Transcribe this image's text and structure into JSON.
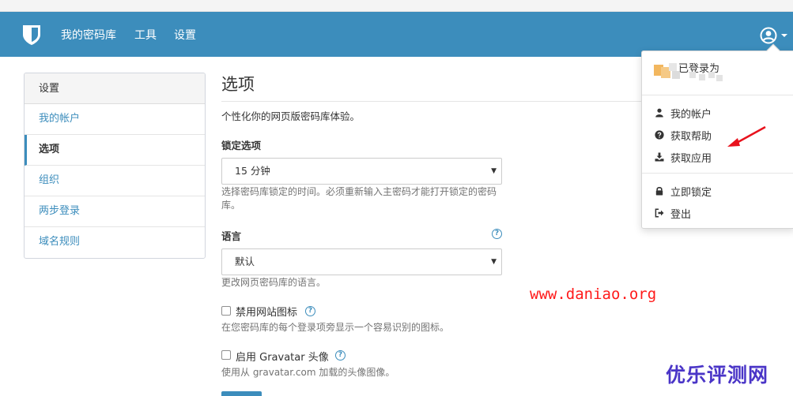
{
  "navbar": {
    "items": [
      "我的密码库",
      "工具",
      "设置"
    ],
    "color": "#3c8dbc"
  },
  "sidebar": {
    "header": "设置",
    "items": [
      {
        "label": "我的帐户",
        "active": false
      },
      {
        "label": "选项",
        "active": true
      },
      {
        "label": "组织",
        "active": false
      },
      {
        "label": "两步登录",
        "active": false
      },
      {
        "label": "域名规则",
        "active": false
      }
    ]
  },
  "main": {
    "title": "选项",
    "subtitle": "个性化你的网页版密码库体验。",
    "lock": {
      "label": "锁定选项",
      "value": "15 分钟",
      "help": "选择密码库锁定的时间。必须重新输入主密码才能打开锁定的密码库。"
    },
    "language": {
      "label": "语言",
      "value": "默认",
      "help": "更改网页密码库的语言。"
    },
    "disable_icons": {
      "label": "禁用网站图标",
      "help": "在您密码库的每个登录项旁显示一个容易识别的图标。",
      "checked": false
    },
    "gravatar": {
      "label": "启用 Gravatar 头像",
      "help": "使用从 gravatar.com 加载的头像图像。",
      "checked": false
    }
  },
  "dropdown": {
    "status": "已登录为",
    "items": [
      {
        "label": "我的帐户",
        "icon": "user-icon"
      },
      {
        "label": "获取帮助",
        "icon": "question-circle-icon"
      },
      {
        "label": "获取应用",
        "icon": "download-icon"
      },
      {
        "label": "立即锁定",
        "icon": "lock-icon"
      },
      {
        "label": "登出",
        "icon": "sign-out-icon"
      }
    ]
  },
  "watermarks": {
    "url": "www.daniao.org",
    "site": "优乐评测网"
  }
}
